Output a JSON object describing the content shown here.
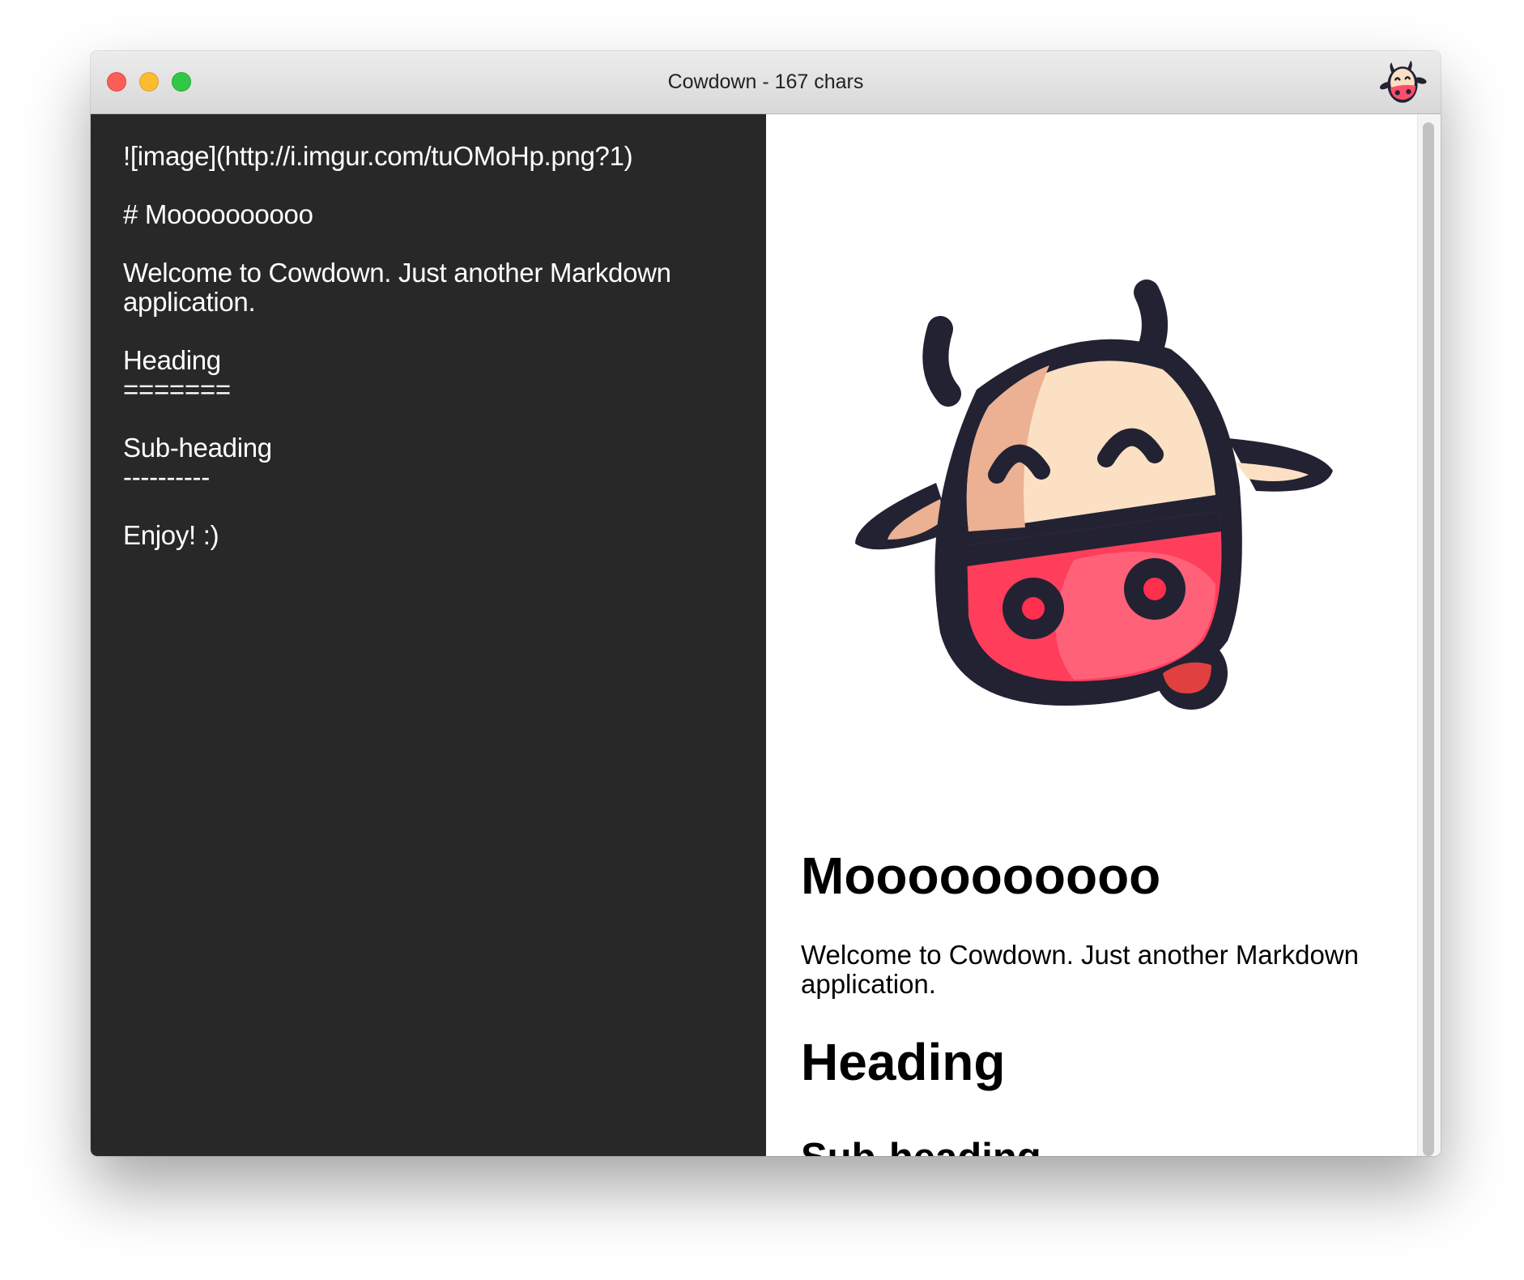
{
  "window": {
    "title": "Cowdown - 167 chars",
    "app_icon": "cow-icon"
  },
  "editor": {
    "lines": [
      "![image](http://i.imgur.com/tuOMoHp.png?1)",
      "",
      "# Moooooooooo",
      "",
      "Welcome to Cowdown. Just another Markdown",
      "application.",
      "",
      "Heading",
      "=======",
      "",
      "Sub-heading",
      "----------",
      "",
      "Enjoy! :)"
    ]
  },
  "preview": {
    "image_alt": "image",
    "h1": "Moooooooooo",
    "paragraph": "Welcome to Cowdown. Just another Markdown application.",
    "h2": "Heading",
    "h3": "Sub-heading"
  },
  "colors": {
    "editor_bg": "#282828",
    "cow_outline": "#222233",
    "cow_face": "#fbe0c4",
    "cow_face_shade": "#ecb092",
    "cow_snout": "#ff3e5c",
    "cow_nostril": "#ff2f4e"
  }
}
